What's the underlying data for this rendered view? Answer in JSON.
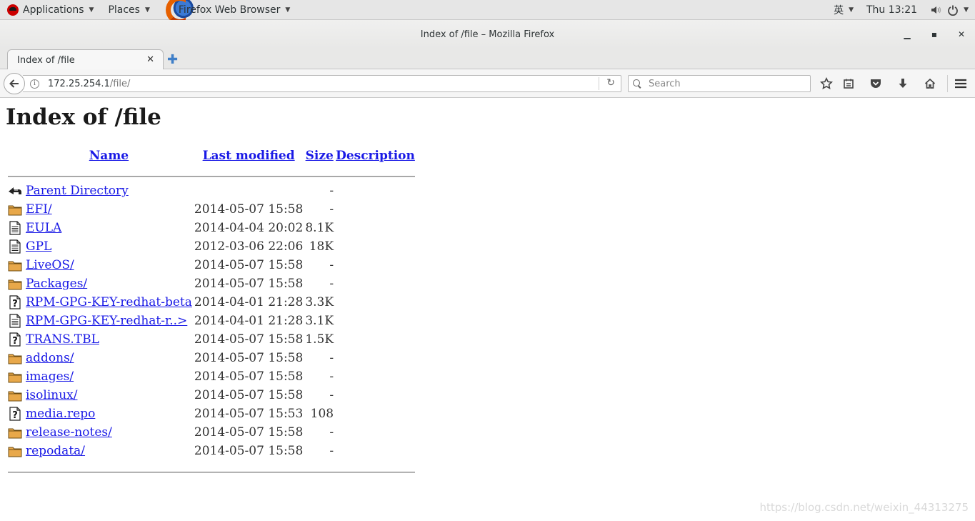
{
  "topbar": {
    "applications": "Applications",
    "places": "Places",
    "browser_app": "Firefox Web Browser",
    "input_method": "英",
    "clock": "Thu 13:21"
  },
  "window": {
    "title": "Index of /file – Mozilla Firefox"
  },
  "tabs": [
    {
      "label": "Index of /file"
    }
  ],
  "navbar": {
    "url_host": "172.25.254.1",
    "url_path": "/file/",
    "search_placeholder": "Search"
  },
  "page": {
    "heading": "Index of /file",
    "columns": {
      "name": "Name",
      "last_modified": "Last modified",
      "size": "Size",
      "description": "Description"
    },
    "rows": [
      {
        "icon": "back-icon",
        "name": "Parent Directory",
        "modified": "",
        "size": "-"
      },
      {
        "icon": "folder-icon",
        "name": "EFI/",
        "modified": "2014-05-07 15:58",
        "size": "-"
      },
      {
        "icon": "text-file-icon",
        "name": "EULA",
        "modified": "2014-04-04 20:02",
        "size": "8.1K"
      },
      {
        "icon": "text-file-icon",
        "name": "GPL",
        "modified": "2012-03-06 22:06",
        "size": "18K"
      },
      {
        "icon": "folder-icon",
        "name": "LiveOS/",
        "modified": "2014-05-07 15:58",
        "size": "-"
      },
      {
        "icon": "folder-icon",
        "name": "Packages/",
        "modified": "2014-05-07 15:58",
        "size": "-"
      },
      {
        "icon": "unknown-file-icon",
        "name": "RPM-GPG-KEY-redhat-beta",
        "modified": "2014-04-01 21:28",
        "size": "3.3K"
      },
      {
        "icon": "text-file-icon",
        "name": "RPM-GPG-KEY-redhat-r..>",
        "modified": "2014-04-01 21:28",
        "size": "3.1K"
      },
      {
        "icon": "unknown-file-icon",
        "name": "TRANS.TBL",
        "modified": "2014-05-07 15:58",
        "size": "1.5K"
      },
      {
        "icon": "folder-icon",
        "name": "addons/",
        "modified": "2014-05-07 15:58",
        "size": "-"
      },
      {
        "icon": "folder-icon",
        "name": "images/",
        "modified": "2014-05-07 15:58",
        "size": "-"
      },
      {
        "icon": "folder-icon",
        "name": "isolinux/",
        "modified": "2014-05-07 15:58",
        "size": "-"
      },
      {
        "icon": "unknown-file-icon",
        "name": "media.repo",
        "modified": "2014-05-07 15:53",
        "size": "108"
      },
      {
        "icon": "folder-icon",
        "name": "release-notes/",
        "modified": "2014-05-07 15:58",
        "size": "-"
      },
      {
        "icon": "folder-icon",
        "name": "repodata/",
        "modified": "2014-05-07 15:58",
        "size": "-"
      }
    ]
  },
  "watermark": "https://blog.csdn.net/weixin_44313275"
}
